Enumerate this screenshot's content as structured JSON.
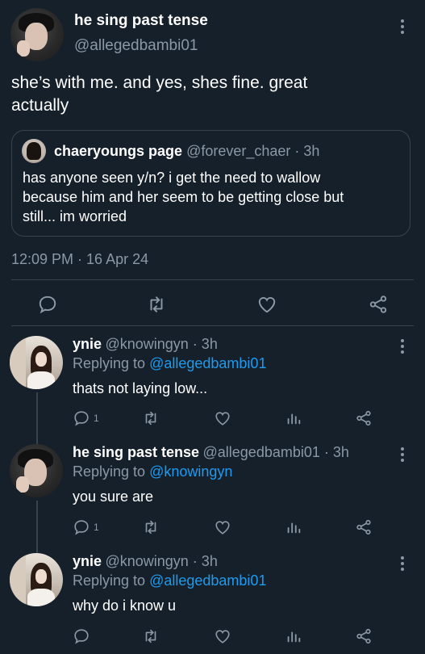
{
  "main_tweet": {
    "display_name": "he sing past tense",
    "handle": "@allegedbambi01",
    "text_line1": "she’s with me. and yes, shes fine. great",
    "text_line2": "actually",
    "timestamp": "12:09 PM · 16 Apr 24",
    "quoted": {
      "display_name": "chaeryoungs page",
      "handle_time": "@forever_chaer · 3h",
      "line1": "has anyone seen y/n? i get the need to wallow",
      "line2": "because him and her seem to be getting close but",
      "line3": "still... im worried"
    }
  },
  "replies": [
    {
      "display_name": "ynie",
      "handle_time": "@knowingyn · 3h",
      "replying_prefix": "Replying to",
      "replying_to": "@allegedbambi01",
      "text": "thats not laying low...",
      "reply_count": "1"
    },
    {
      "display_name": "he sing past tense",
      "handle_time": "@allegedbambi01 · 3h",
      "replying_prefix": "Replying to",
      "replying_to": "@knowingyn",
      "text": "you sure are",
      "reply_count": "1"
    },
    {
      "display_name": "ynie",
      "handle_time": "@knowingyn · 3h",
      "replying_prefix": "Replying to",
      "replying_to": "@allegedbambi01",
      "text": "why do i know u",
      "reply_count": ""
    }
  ],
  "icons": [
    "reply-icon",
    "retweet-icon",
    "like-icon",
    "share-icon",
    "analytics-icon",
    "more-icon"
  ],
  "colors": {
    "background": "#15202b",
    "muted": "#8b98a5",
    "link": "#1d9bf0",
    "border": "#38444d"
  }
}
